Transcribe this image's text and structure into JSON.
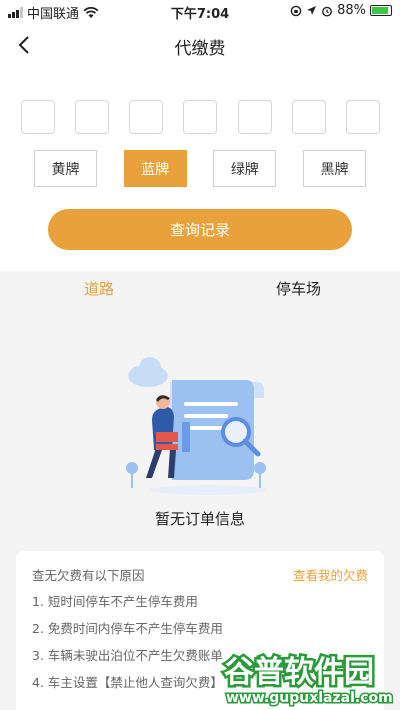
{
  "status_bar": {
    "carrier": "中国联通",
    "time": "下午7:04",
    "battery": "88%",
    "battery_level": 0.88
  },
  "header": {
    "title": "代缴费"
  },
  "plate": {
    "box_count": 7,
    "colors": [
      {
        "label": "黄牌",
        "active": false
      },
      {
        "label": "蓝牌",
        "active": true
      },
      {
        "label": "绿牌",
        "active": false
      },
      {
        "label": "黑牌",
        "active": false
      }
    ],
    "query_button": "查询记录"
  },
  "tabs": [
    {
      "label": "道路",
      "active": true
    },
    {
      "label": "停车场",
      "active": false
    }
  ],
  "empty_state": {
    "message": "暂无订单信息"
  },
  "reasons": {
    "title": "查无欠费有以下原因",
    "link": "查看我的欠费",
    "items": [
      "1. 短时间停车不产生停车费用",
      "2. 免费时间内停车不产生停车费用",
      "3. 车辆未驶出泊位不产生欠费账单",
      "4. 车主设置【禁止他人查询欠费】"
    ]
  },
  "watermark": {
    "brand": "谷普软件园",
    "url": "www.gupuxlazal.com"
  },
  "colors": {
    "accent": "#e9a13b",
    "background": "#f4f4f4"
  }
}
